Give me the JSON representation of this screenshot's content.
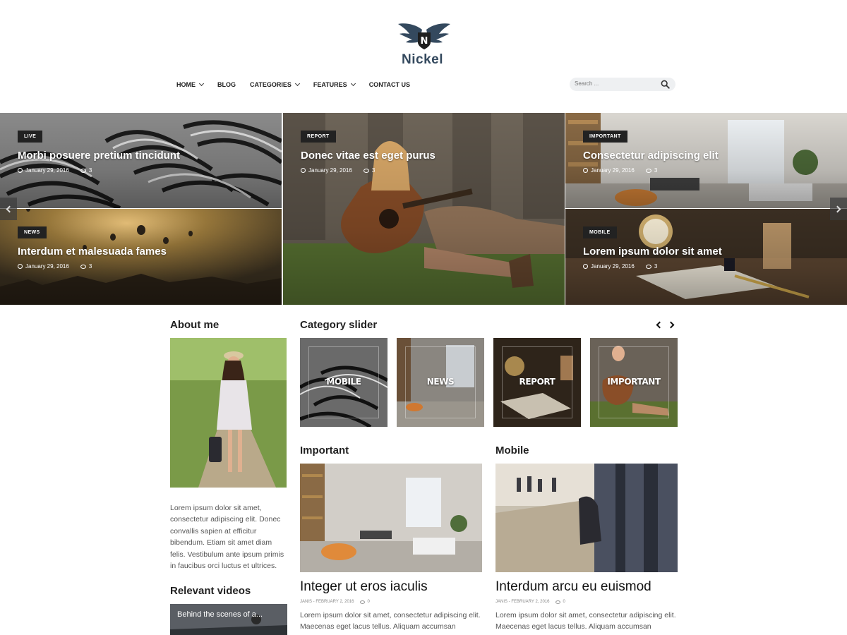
{
  "brand": {
    "name": "Nickel",
    "logo_letter": "N"
  },
  "nav": {
    "items": [
      {
        "label": "HOME",
        "has_dropdown": true
      },
      {
        "label": "BLOG",
        "has_dropdown": false
      },
      {
        "label": "CATEGORIES",
        "has_dropdown": true
      },
      {
        "label": "FEATURES",
        "has_dropdown": true
      },
      {
        "label": "CONTACT US",
        "has_dropdown": false
      }
    ]
  },
  "search": {
    "placeholder": "Search ..."
  },
  "hero": {
    "tiles": [
      {
        "badge": "LIVE",
        "title": "Morbi posuere pretium tincidunt",
        "date": "January 29, 2016",
        "comments": "3"
      },
      {
        "badge": "NEWS",
        "title": "Interdum et malesuada fames",
        "date": "January 29, 2016",
        "comments": "3"
      },
      {
        "badge": "REPORT",
        "title": "Donec vitae est eget purus",
        "date": "January 29, 2016",
        "comments": "3"
      },
      {
        "badge": "IMPORTANT",
        "title": "Consectetur adipiscing elit",
        "date": "January 29, 2016",
        "comments": "3"
      },
      {
        "badge": "MOBILE",
        "title": "Lorem ipsum dolor sit amet",
        "date": "January 29, 2016",
        "comments": "3"
      }
    ]
  },
  "sidebar": {
    "about_title": "About me",
    "about_text": "Lorem ipsum dolor sit amet, consectetur adipiscing elit. Donec convallis sapien at efficitur bibendum. Etiam sit amet diam felis. Vestibulum ante ipsum primis in faucibus orci luctus et ultrices.",
    "videos_title": "Relevant videos",
    "video_caption": "Behind the scenes of a..."
  },
  "category_slider": {
    "title": "Category slider",
    "items": [
      "MOBILE",
      "NEWS",
      "REPORT",
      "IMPORTANT"
    ]
  },
  "sections": [
    {
      "heading": "Important",
      "post_title": "Integer ut eros iaculis",
      "author_date": "JANIS - FEBRUARY 2, 2016",
      "comments": "0",
      "excerpt": "Lorem ipsum dolor sit amet, consectetur adipiscing elit. Maecenas eget lacus tellus. Aliquam accumsan"
    },
    {
      "heading": "Mobile",
      "post_title": "Interdum arcu eu euismod",
      "author_date": "JANIS - FEBRUARY 2, 2016",
      "comments": "0",
      "excerpt": "Lorem ipsum dolor sit amet, consectetur adipiscing elit. Maecenas eget lacus tellus. Aliquam accumsan"
    }
  ],
  "colors": {
    "brand_text": "#34495e",
    "badge_bg": "#222222",
    "search_bg": "#eef0f2"
  }
}
